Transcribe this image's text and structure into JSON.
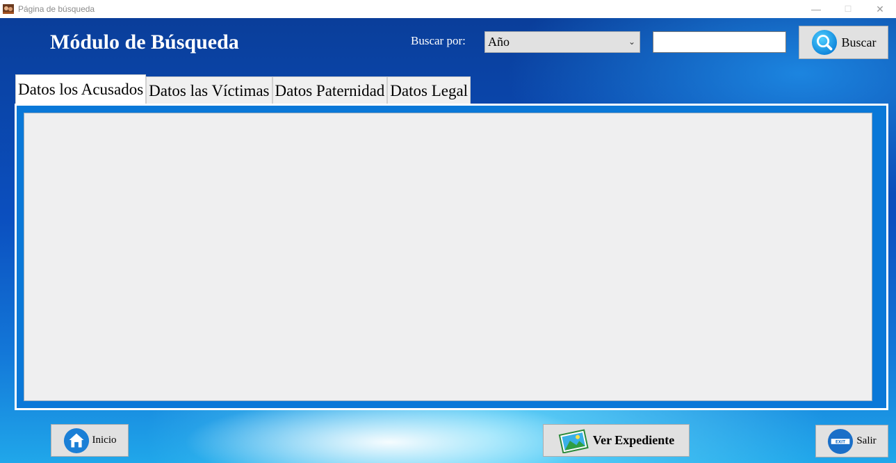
{
  "window": {
    "title": "Página de búsqueda",
    "minimize_glyph": "—",
    "maximize_glyph": "☐",
    "close_glyph": "✕"
  },
  "header": {
    "title": "Módulo de Búsqueda",
    "search_by_label": "Buscar por:",
    "search_by_selected": "Año",
    "search_value": "",
    "search_button_label": "Buscar"
  },
  "tabs": [
    {
      "label": "Datos los Acusados",
      "active": true
    },
    {
      "label": "Datos las Víctimas",
      "active": false
    },
    {
      "label": "Datos Paternidad",
      "active": false
    },
    {
      "label": "Datos Legal",
      "active": false
    }
  ],
  "footer": {
    "inicio_label": "Inicio",
    "expediente_label": "Ver Expediente",
    "salir_label": "Salir",
    "exit_sign_text": "EXIT"
  },
  "icons": {
    "search": "search-icon",
    "home": "home-icon",
    "image": "image-icon",
    "exit": "exit-icon"
  },
  "colors": {
    "accent_blue": "#0a78d8",
    "button_bg": "#e1e1e1",
    "grid_bg": "#efeff0"
  }
}
